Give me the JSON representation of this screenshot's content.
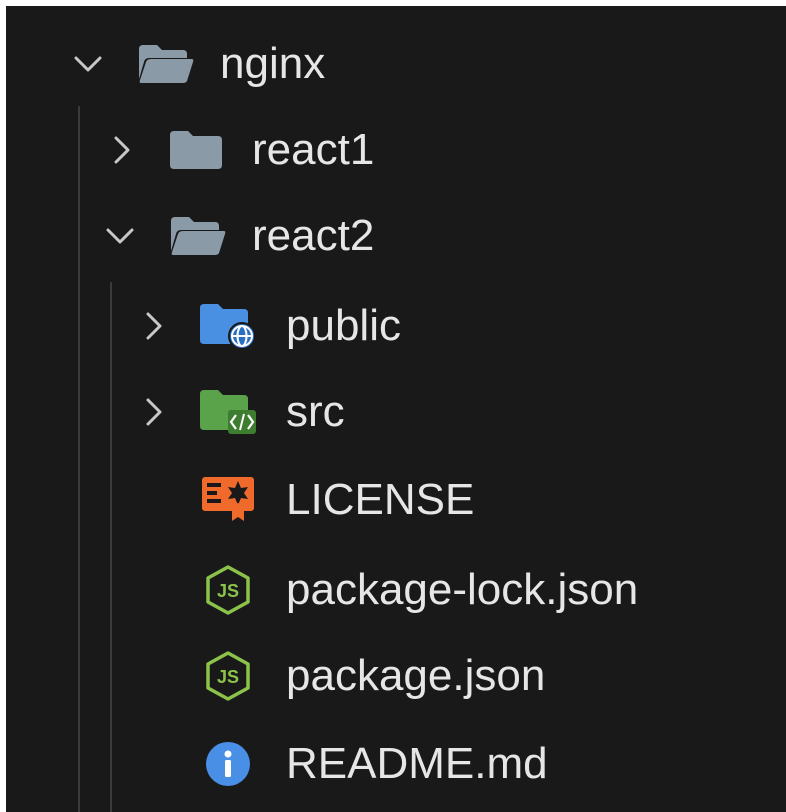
{
  "explorer": {
    "nodes": [
      {
        "label": "nginx",
        "type": "folder",
        "expanded": true,
        "icon": "folder-open-icon"
      },
      {
        "label": "react1",
        "type": "folder",
        "expanded": false,
        "icon": "folder-closed-icon"
      },
      {
        "label": "react2",
        "type": "folder",
        "expanded": true,
        "icon": "folder-open-icon"
      },
      {
        "label": "public",
        "type": "folder",
        "expanded": false,
        "icon": "folder-public-icon"
      },
      {
        "label": "src",
        "type": "folder",
        "expanded": false,
        "icon": "folder-src-icon"
      },
      {
        "label": "LICENSE",
        "type": "file",
        "icon": "license-icon"
      },
      {
        "label": "package-lock.json",
        "type": "file",
        "icon": "nodejs-icon"
      },
      {
        "label": "package.json",
        "type": "file",
        "icon": "nodejs-icon"
      },
      {
        "label": "README.md",
        "type": "file",
        "icon": "info-icon"
      }
    ]
  },
  "colors": {
    "background": "#191919",
    "text": "#e6e6e6",
    "chevron": "#c8c8c8",
    "folder": "#8a9aa7",
    "public_folder": "#4a90e2",
    "src_folder": "#5aa34a",
    "license": "#f06a2c",
    "nodejs": "#8bc34a",
    "info": "#4a8fe6"
  }
}
